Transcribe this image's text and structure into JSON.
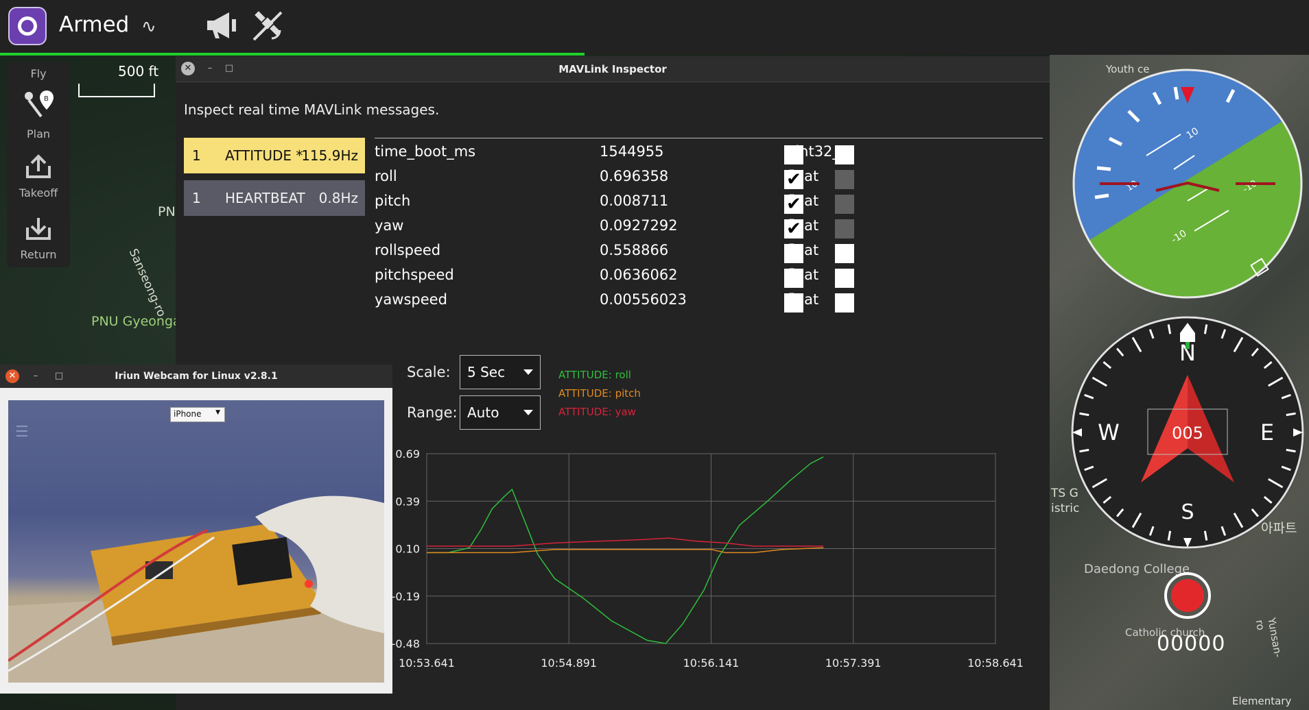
{
  "toolbar": {
    "status": "Armed",
    "icons": [
      "qgc-logo-icon",
      "vibration-icon",
      "megaphone-icon",
      "gps-icon"
    ]
  },
  "toolstrip": {
    "items": [
      {
        "label": "Fly",
        "icon": "fly-icon"
      },
      {
        "label": "Plan",
        "icon": "plan-icon"
      },
      {
        "label": "Takeoff",
        "icon": "takeoff-icon"
      },
      {
        "label": "Return",
        "icon": "return-icon"
      }
    ]
  },
  "map": {
    "scale_label": "500 ft",
    "labels": [
      "PN",
      "Sanseong-ro",
      "PNU Gyeonga",
      "Youth ce",
      "Daedong College",
      "Catholic church",
      "Elementary",
      "Yunsan-ro",
      "TS G",
      "istric",
      "아파트"
    ]
  },
  "inspector": {
    "title": "MAVLink Inspector",
    "description": "Inspect real time MAVLink messages.",
    "messages": [
      {
        "sysid": "1",
        "name": "ATTITUDE *",
        "rate": "115.9Hz",
        "selected": true
      },
      {
        "sysid": "1",
        "name": "HEARTBEAT",
        "rate": "0.8Hz",
        "selected": false
      }
    ],
    "fields": [
      {
        "name": "time_boot_ms",
        "value": "1544955",
        "type": "uint32_t",
        "plot1": false,
        "plot2": false
      },
      {
        "name": "roll",
        "value": "0.696358",
        "type": "float",
        "plot1": true,
        "plot2": "dim"
      },
      {
        "name": "pitch",
        "value": "0.008711",
        "type": "float",
        "plot1": true,
        "plot2": "dim"
      },
      {
        "name": "yaw",
        "value": "0.0927292",
        "type": "float",
        "plot1": true,
        "plot2": "dim"
      },
      {
        "name": "rollspeed",
        "value": "0.558866",
        "type": "float",
        "plot1": false,
        "plot2": false
      },
      {
        "name": "pitchspeed",
        "value": "0.0636062",
        "type": "float",
        "plot1": false,
        "plot2": false
      },
      {
        "name": "yawspeed",
        "value": "0.00556023",
        "type": "float",
        "plot1": false,
        "plot2": false
      }
    ],
    "scale_label": "Scale:",
    "scale_value": "5 Sec",
    "range_label": "Range:",
    "range_value": "Auto",
    "colors": {
      "roll": "#2fbf3c",
      "pitch": "#e18a1e",
      "yaw": "#d8233a",
      "selected": "#f7e07a"
    }
  },
  "chart_data": {
    "type": "line",
    "x": [
      "10:53.641",
      "10:54.891",
      "10:56.141",
      "10:57.391",
      "10:58.641"
    ],
    "ylim": [
      -0.48,
      0.69
    ],
    "yticks": [
      "0.69",
      "0.39",
      "0.10",
      "-0.19",
      "-0.48"
    ],
    "grid": true,
    "legend_placement": "top-left",
    "series": [
      {
        "name": "ATTITUDE: roll",
        "color": "#2fbf3c",
        "points": [
          [
            0,
            0.08
          ],
          [
            0.15,
            0.08
          ],
          [
            0.3,
            0.11
          ],
          [
            0.38,
            0.22
          ],
          [
            0.46,
            0.35
          ],
          [
            0.55,
            0.43
          ],
          [
            0.6,
            0.47
          ],
          [
            0.7,
            0.25
          ],
          [
            0.78,
            0.07
          ],
          [
            0.9,
            -0.08
          ],
          [
            1.1,
            -0.2
          ],
          [
            1.3,
            -0.34
          ],
          [
            1.55,
            -0.46
          ],
          [
            1.68,
            -0.48
          ],
          [
            1.8,
            -0.36
          ],
          [
            1.95,
            -0.15
          ],
          [
            2.05,
            0.05
          ],
          [
            2.2,
            0.25
          ],
          [
            2.4,
            0.4
          ],
          [
            2.55,
            0.52
          ],
          [
            2.7,
            0.63
          ],
          [
            2.79,
            0.67
          ]
        ]
      },
      {
        "name": "ATTITUDE: pitch",
        "color": "#e18a1e",
        "points": [
          [
            0,
            0.08
          ],
          [
            0.3,
            0.08
          ],
          [
            0.6,
            0.08
          ],
          [
            0.9,
            0.1
          ],
          [
            1.2,
            0.1
          ],
          [
            1.5,
            0.1
          ],
          [
            1.8,
            0.1
          ],
          [
            2.0,
            0.1
          ],
          [
            2.1,
            0.08
          ],
          [
            2.3,
            0.08
          ],
          [
            2.5,
            0.1
          ],
          [
            2.79,
            0.11
          ]
        ]
      },
      {
        "name": "ATTITUDE: yaw",
        "color": "#d8233a",
        "points": [
          [
            0,
            0.12
          ],
          [
            0.3,
            0.12
          ],
          [
            0.6,
            0.12
          ],
          [
            0.9,
            0.14
          ],
          [
            1.2,
            0.15
          ],
          [
            1.5,
            0.16
          ],
          [
            1.7,
            0.17
          ],
          [
            1.9,
            0.15
          ],
          [
            2.1,
            0.14
          ],
          [
            2.3,
            0.12
          ],
          [
            2.5,
            0.12
          ],
          [
            2.79,
            0.12
          ]
        ]
      }
    ]
  },
  "webcam": {
    "title": "Iriun Webcam for Linux v2.8.1",
    "device": "iPhone"
  },
  "instruments": {
    "attitude_ticks": [
      "10",
      "-10",
      "10",
      "-10"
    ],
    "compass": {
      "north": "N",
      "south": "S",
      "east": "E",
      "west": "W",
      "heading": "005"
    },
    "record_count": "00000"
  }
}
